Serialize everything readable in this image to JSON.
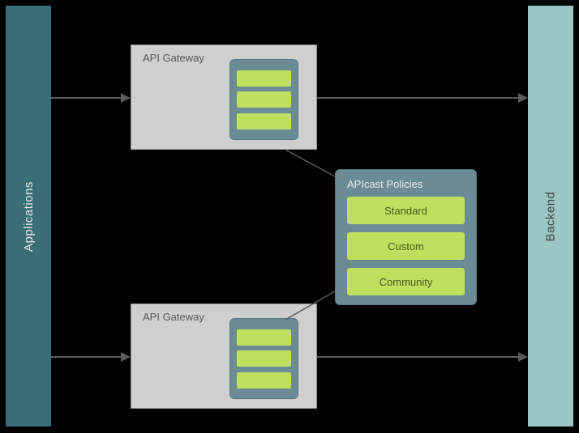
{
  "applications": {
    "label": "Applications"
  },
  "backend": {
    "label": "Backend"
  },
  "gateway_top": {
    "title": "API Gateway"
  },
  "gateway_bottom": {
    "title": "API Gateway"
  },
  "policies": {
    "title": "APIcast Policies",
    "items": [
      "Standard",
      "Custom",
      "Community"
    ]
  }
}
